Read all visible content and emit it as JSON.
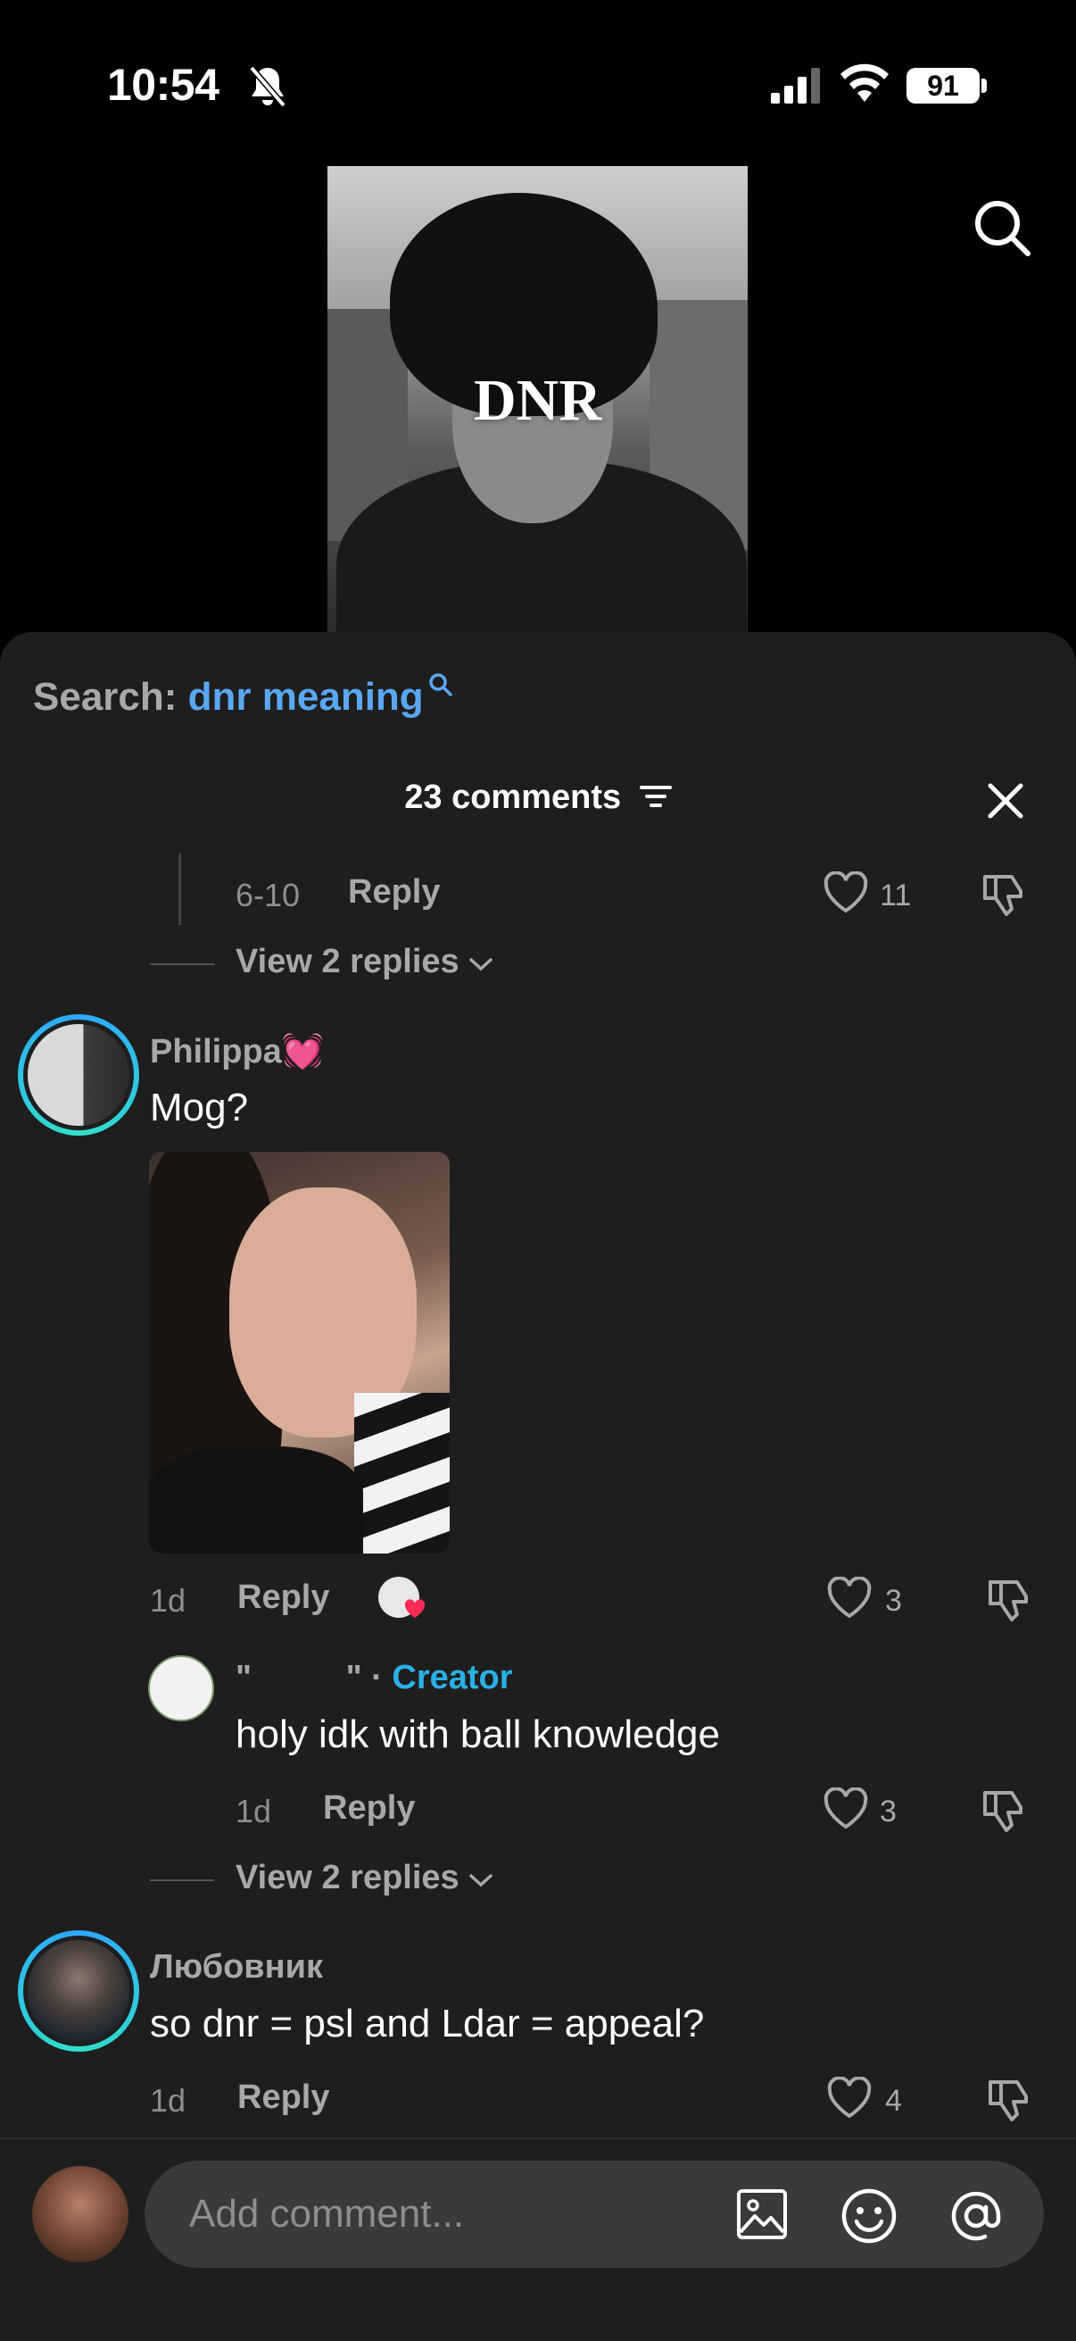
{
  "status_bar": {
    "time": "10:54",
    "battery": "91"
  },
  "video": {
    "overlay_title": "DNR"
  },
  "search": {
    "prefix": "Search:",
    "term": "dnr meaning"
  },
  "header": {
    "comments_count": "23 comments"
  },
  "previous_comment": {
    "date": "6-10",
    "reply_label": "Reply",
    "likes": "11",
    "view_replies": "View 2 replies"
  },
  "comments": [
    {
      "username": "Philippa💓",
      "text": "Mog?",
      "date": "1d",
      "reply_label": "Reply",
      "likes": "3",
      "reply": {
        "username": "\"          \"",
        "separator": "·",
        "tag": "Creator",
        "text": "holy idk with ball knowledge",
        "date": "1d",
        "reply_label": "Reply",
        "likes": "3"
      },
      "view_replies": "View 2 replies"
    },
    {
      "username": "Любовник",
      "text": "so dnr = psl and Ldar = appeal?",
      "date": "1d",
      "reply_label": "Reply",
      "likes": "4"
    }
  ],
  "composer": {
    "placeholder": "Add comment..."
  },
  "colors": {
    "accent_link": "#5aa7f2",
    "creator": "#2bb0e6",
    "sheet_bg": "#1e1e1f"
  }
}
